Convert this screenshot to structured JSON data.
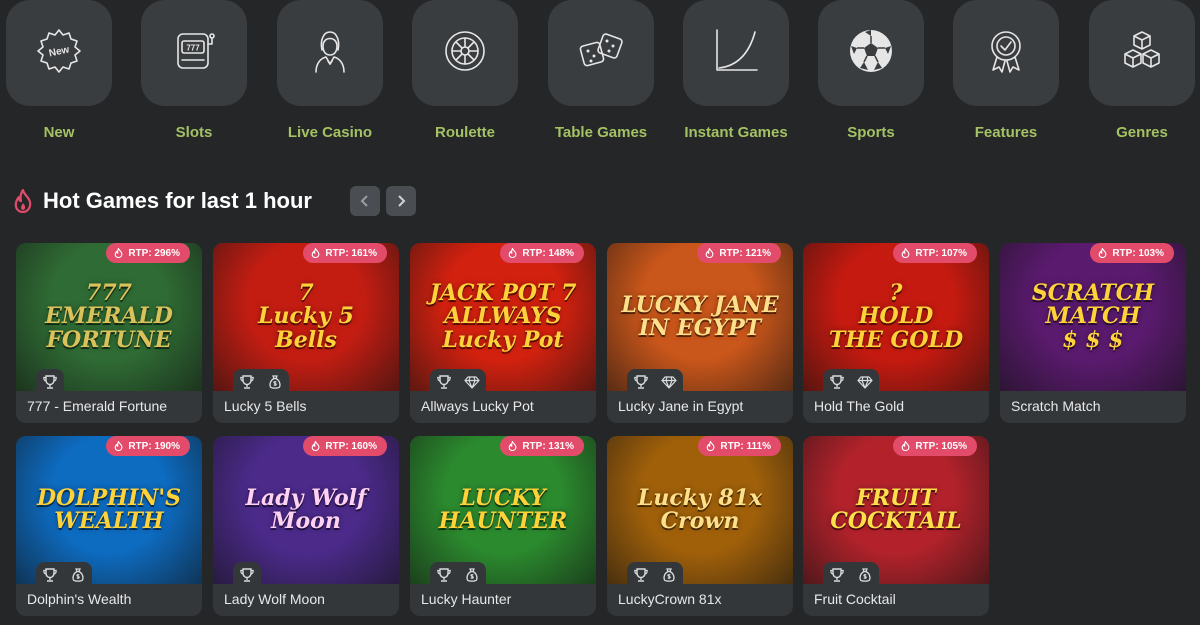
{
  "categories": [
    {
      "label": "New",
      "icon": "new-badge-icon"
    },
    {
      "label": "Slots",
      "icon": "slot-machine-icon"
    },
    {
      "label": "Live Casino",
      "icon": "dealer-icon"
    },
    {
      "label": "Roulette",
      "icon": "roulette-icon"
    },
    {
      "label": "Table Games",
      "icon": "dice-icon"
    },
    {
      "label": "Instant Games",
      "icon": "curve-graph-icon"
    },
    {
      "label": "Sports",
      "icon": "soccer-ball-icon"
    },
    {
      "label": "Features",
      "icon": "award-icon"
    },
    {
      "label": "Genres",
      "icon": "cubes-icon"
    }
  ],
  "new_badge_text": "New",
  "slot_reels_text": "777",
  "hot": {
    "title": "Hot Games for last 1 hour",
    "icon": "fire-icon"
  },
  "games": [
    {
      "name": "777 - Emerald Fortune",
      "rtp": "RTP: 296%",
      "art": "777\nEMERALD FORTUNE",
      "bg": "#2f6b34",
      "fg": "#d9c25a"
    },
    {
      "name": "Lucky 5 Bells",
      "rtp": "RTP: 161%",
      "art": "7\nLucky 5\nBells",
      "bg": "#c31d12",
      "fg": "#ffd23a"
    },
    {
      "name": "Allways Lucky Pot",
      "rtp": "RTP: 148%",
      "art": "JACK POT 7\nALLWAYS\nLucky Pot",
      "bg": "#d3210f",
      "fg": "#ffd23a"
    },
    {
      "name": "Lucky Jane in Egypt",
      "rtp": "RTP: 121%",
      "art": "LUCKY JANE IN EGYPT",
      "bg": "#c9561a",
      "fg": "#ffe08a"
    },
    {
      "name": "Hold The Gold",
      "rtp": "RTP: 107%",
      "art": "?\nHOLD\nTHE GOLD",
      "bg": "#c51a10",
      "fg": "#ffd23a"
    },
    {
      "name": "Scratch Match",
      "rtp": "RTP: 103%",
      "art": "SCRATCH\nMATCH\n$ $ $",
      "bg": "#5a1a6e",
      "fg": "#ffd23a"
    },
    {
      "name": "Dolphin's Wealth",
      "rtp": "RTP: 190%",
      "art": "DOLPHIN'S\nWEALTH",
      "bg": "#0d6bc0",
      "fg": "#ffd23a"
    },
    {
      "name": "Lady Wolf Moon",
      "rtp": "RTP: 160%",
      "art": "Lady Wolf Moon",
      "bg": "#4b2a8a",
      "fg": "#ffd1f2"
    },
    {
      "name": "Lucky Haunter",
      "rtp": "RTP: 131%",
      "art": "LUCKY\nHAUNTER",
      "bg": "#2b8a2e",
      "fg": "#ffd23a"
    },
    {
      "name": "LuckyCrown 81x",
      "rtp": "RTP: 111%",
      "art": "Lucky 81x\nCrown",
      "bg": "#a0600a",
      "fg": "#ffe08a"
    },
    {
      "name": "Fruit Cocktail",
      "rtp": "RTP: 105%",
      "art": "FRUIT COCKTAIL",
      "bg": "#b3222b",
      "fg": "#ffe04a"
    }
  ],
  "card_badges": [
    [
      "trophy-icon"
    ],
    [
      "trophy-icon",
      "money-bag-icon"
    ],
    [
      "trophy-icon",
      "diamond-icon"
    ],
    [
      "trophy-icon",
      "diamond-icon"
    ],
    [
      "trophy-icon",
      "diamond-icon"
    ],
    [],
    [
      "trophy-icon",
      "money-bag-icon"
    ],
    [
      "trophy-icon"
    ],
    [
      "trophy-icon",
      "money-bag-icon"
    ],
    [
      "trophy-icon",
      "money-bag-icon"
    ],
    [
      "trophy-icon",
      "money-bag-icon"
    ]
  ],
  "colors": {
    "background": "#242628",
    "tile": "#3a3d40",
    "category_label": "#a4c263",
    "rtp_badge": "#e24b6a",
    "card": "#34373a"
  }
}
